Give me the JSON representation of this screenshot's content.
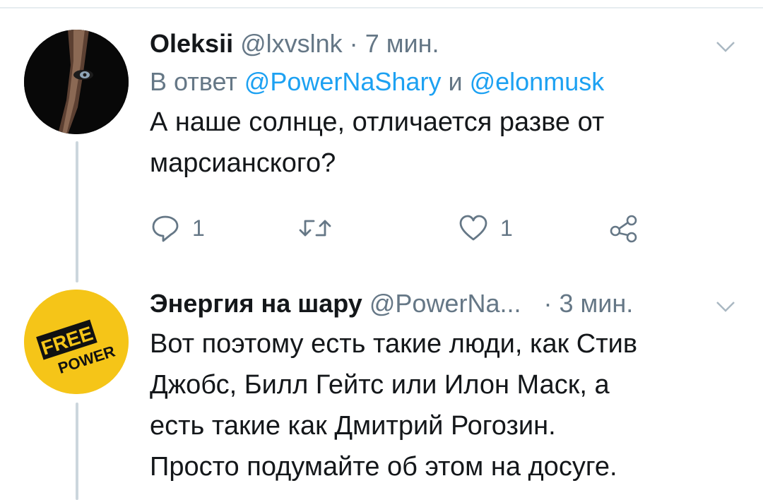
{
  "tweets": [
    {
      "display_name": "Oleksii",
      "handle": "@lxvslnk",
      "separator": "·",
      "time": "7 мин.",
      "reply_prefix": "В ответ",
      "reply_mention_1": "@PowerNaShary",
      "reply_joiner": "и",
      "reply_mention_2": "@elonmusk",
      "text_line_1": "А наше солнце, отличается разве от",
      "text_line_2": "марсианского?",
      "actions": {
        "reply_count": "1",
        "like_count": "1"
      }
    },
    {
      "display_name": "Энергия на шару",
      "handle": "@PowerNa...",
      "separator": "·",
      "time": "3 мин.",
      "avatar_line_1": "FREE",
      "avatar_line_2": "POWER",
      "avatar_color": "#f5c518",
      "text_line_1": "Вот поэтому есть такие люди, как Стив",
      "text_line_2": "Джобс, Билл Гейтс или Илон Маск, а",
      "text_line_3": "есть такие как Дмитрий Рогозин.",
      "text_line_4": "Просто подумайте об этом на досуге."
    }
  ],
  "colors": {
    "link": "#1da1f2",
    "muted": "#657786",
    "thread_line": "#ccd6dd"
  }
}
